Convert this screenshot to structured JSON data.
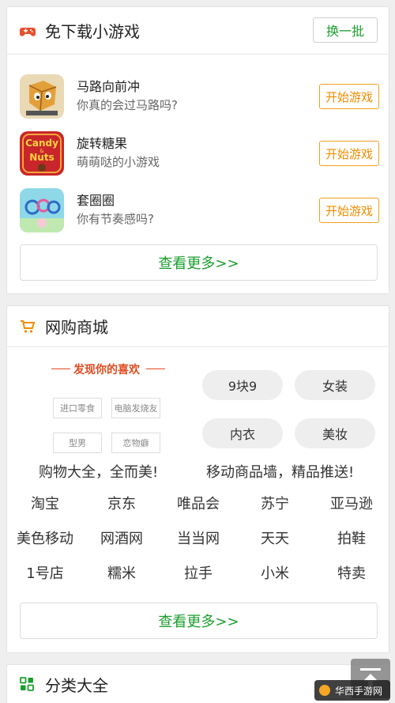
{
  "games_section": {
    "title": "免下载小游戏",
    "swap_label": "换一批",
    "games": [
      {
        "name": "马路向前冲",
        "desc": "你真的会过马路吗?",
        "play_label": "开始游戏",
        "icon": "dice-character-icon"
      },
      {
        "name": "旋转糖果",
        "desc": "萌萌哒的小游戏",
        "play_label": "开始游戏",
        "icon": "candy-nuts-icon"
      },
      {
        "name": "套圈圈",
        "desc": "你有节奏感吗?",
        "play_label": "开始游戏",
        "icon": "ring-toss-icon"
      }
    ],
    "more_label": "查看更多>>"
  },
  "shop_section": {
    "title": "网购商城",
    "promo": {
      "title": "发现你的喜欢",
      "chips": [
        "进口零食",
        "电脑发烧友",
        "型男",
        "恋物癖"
      ]
    },
    "pills": [
      "9块9",
      "女装",
      "内衣",
      "美妆"
    ],
    "caption_left": "购物大全，全而美!",
    "caption_right": "移动商品墙，精品推送!",
    "links": [
      [
        "淘宝",
        "京东",
        "唯品会",
        "苏宁",
        "亚马逊"
      ],
      [
        "美色移动",
        "网酒网",
        "当当网",
        "天天",
        "拍鞋"
      ],
      [
        "1号店",
        "糯米",
        "拉手",
        "小米",
        "特卖"
      ]
    ],
    "more_label": "查看更多>>"
  },
  "category_section": {
    "title": "分类大全"
  },
  "watermark": "华西手游网",
  "colors": {
    "green": "#1a9e2c",
    "orange": "#f08c00",
    "icon_red": "#e8502b"
  }
}
